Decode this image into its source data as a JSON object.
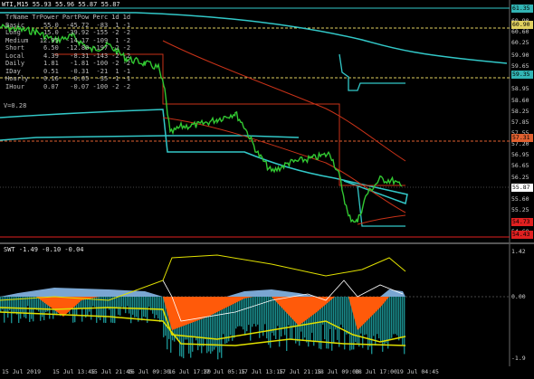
{
  "main": {
    "title": "WTI,M15  55.93 55.96 55.87 55.87",
    "price_ticks": [
      "61.35",
      "60.90",
      "60.60",
      "60.25",
      "59.90",
      "59.65",
      "59.35",
      "58.95",
      "58.60",
      "58.25",
      "57.85",
      "57.55",
      "57.20",
      "56.95",
      "56.65",
      "56.25",
      "55.95",
      "55.60",
      "55.25",
      "54.95",
      "54.60",
      "54.25"
    ],
    "price_labels": [
      {
        "text": "61.35",
        "bg": "#32b4b4",
        "fg": "#000000"
      },
      {
        "text": "60.90",
        "bg": "#e0d060",
        "fg": "#000000"
      },
      {
        "text": "59.35",
        "bg": "#32b4b4",
        "fg": "#000000"
      },
      {
        "text": "57.31",
        "bg": "#e06030",
        "fg": "#000000"
      },
      {
        "text": "55.87",
        "bg": "#ffffff",
        "fg": "#000000"
      },
      {
        "text": "54.73",
        "bg": "#e02020",
        "fg": "#000000"
      },
      {
        "text": "54.43",
        "bg": "#e02020",
        "fg": "#000000"
      }
    ],
    "stats_header": [
      "TrName",
      "TrPower",
      "PartPow",
      "Perc",
      "1d",
      "1d"
    ],
    "stats_rows": [
      [
        "Basic",
        "55.0",
        "-45.72",
        "-83",
        "1",
        "-1"
      ],
      [
        "Long",
        "15.0",
        "-39.92",
        "-155",
        "-2",
        "-2"
      ],
      [
        "Medium",
        "12.95",
        "-14.17",
        "-109",
        "1",
        "-2"
      ],
      [
        "Short",
        "6.50",
        "-12.80",
        "-197",
        "-2",
        "-2"
      ],
      [
        "Local",
        "4.39",
        "-8.31",
        "-143",
        "-2",
        "-2"
      ],
      [
        "Daily",
        "1.81",
        "-1.81",
        "-100",
        "-2",
        "-2"
      ],
      [
        "IDay",
        "0.51",
        "-0.31",
        "-21",
        "1",
        "-1"
      ],
      [
        "Hourly",
        "0.16",
        "-0.05",
        "-35",
        "-1",
        "-1"
      ],
      [
        "IHour",
        "0.07",
        "-0.07",
        "-100",
        "-2",
        "-2"
      ]
    ],
    "vol_text": "V=0.28"
  },
  "sub": {
    "title": "SWT -1.49 -0.10 -0.04",
    "ticks": [
      "1.42",
      "0.00",
      "-1.9"
    ]
  },
  "time_ticks": [
    "15 Jul 2019",
    "15 Jul 13:45",
    "15 Jul 21:45",
    "16 Jul 09:30",
    "16 Jul 17:30",
    "17 Jul 05:15",
    "17 Jul 13:15",
    "17 Jul 21:15",
    "18 Jul 09:00",
    "18 Jul 17:00",
    "19 Jul 04:45"
  ],
  "colors": {
    "background": "#000000",
    "candles": "#32c832",
    "trend_cyan": "#32c8c8",
    "trend_red": "#c83218",
    "level_yellow": "#e0d060",
    "osc_orange": "#ff5a0a",
    "osc_blue": "#7aa6d2",
    "osc_teal": "#1a8c8c",
    "osc_yellow": "#e0e000"
  }
}
